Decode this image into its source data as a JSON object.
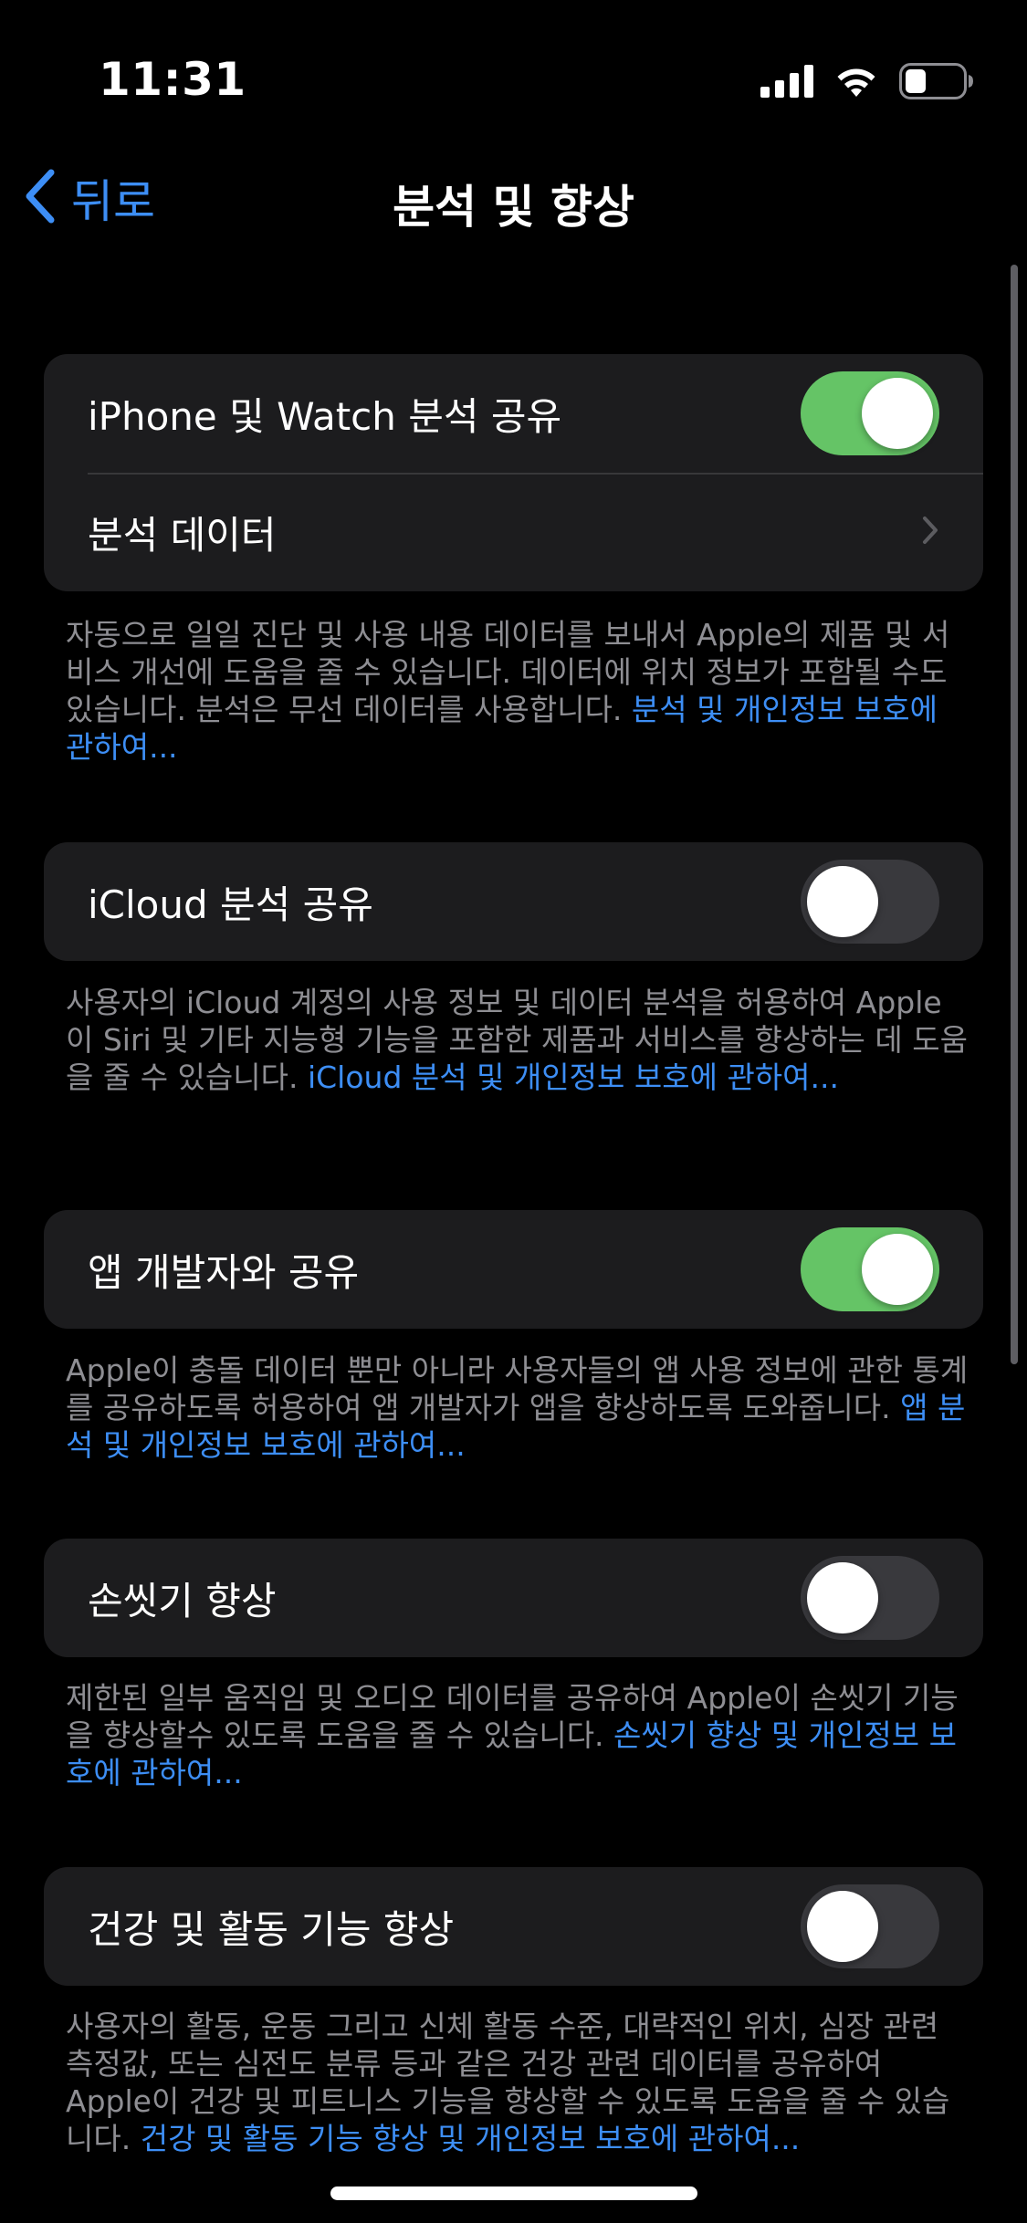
{
  "status_bar": {
    "time": "11:31",
    "icons": [
      "cellular-signal-icon",
      "wifi-icon",
      "battery-icon"
    ]
  },
  "nav": {
    "back_label": "뒤로",
    "title": "분석 및 향상"
  },
  "colors": {
    "background": "#000000",
    "group_background": "#1c1c1e",
    "toggle_on": "#65c466",
    "toggle_off": "#39393d",
    "link": "#3d8ef5",
    "footer_text": "#8e8e93"
  },
  "groups": [
    {
      "rows": [
        {
          "label": "iPhone 및 Watch 분석 공유",
          "type": "toggle",
          "on": true
        },
        {
          "label": "분석 데이터",
          "type": "disclosure"
        }
      ],
      "footer": {
        "text": "자동으로 일일 진단 및 사용 내용 데이터를 보내서 Apple의 제품 및 서비스 개선에 도움을 줄 수 있습니다. 데이터에 위치 정보가 포함될 수도 있습니다. 분석은 무선 데이터를 사용합니다. ",
        "link": "분석 및 개인정보 보호에 관하여..."
      }
    },
    {
      "rows": [
        {
          "label": "iCloud 분석 공유",
          "type": "toggle",
          "on": false
        }
      ],
      "footer": {
        "text": "사용자의 iCloud 계정의 사용 정보 및 데이터 분석을 허용하여 Apple이 Siri 및 기타 지능형 기능을 포함한 제품과 서비스를 향상하는 데 도움을 줄 수 있습니다. ",
        "link": "iCloud 분석 및 개인정보 보호에 관하여..."
      }
    },
    {
      "rows": [
        {
          "label": "앱 개발자와 공유",
          "type": "toggle",
          "on": true
        }
      ],
      "footer": {
        "text": "Apple이 충돌 데이터 뿐만 아니라 사용자들의 앱 사용 정보에 관한 통계를 공유하도록 허용하여 앱 개발자가 앱을 향상하도록 도와줍니다. ",
        "link": "앱 분석 및 개인정보 보호에 관하여..."
      }
    },
    {
      "rows": [
        {
          "label": "손씻기 향상",
          "type": "toggle",
          "on": false
        }
      ],
      "footer": {
        "text": "제한된 일부 움직임 및 오디오 데이터를 공유하여 Apple이 손씻기 기능을 향상할수 있도록 도움을 줄 수 있습니다. ",
        "link": "손씻기 향상 및 개인정보 보호에 관하여..."
      }
    },
    {
      "rows": [
        {
          "label": "건강 및 활동 기능 향상",
          "type": "toggle",
          "on": false
        }
      ],
      "footer": {
        "text": "사용자의 활동, 운동 그리고 신체 활동 수준, 대략적인 위치, 심장 관련 측정값, 또는 심전도 분류 등과 같은 건강 관련 데이터를 공유하여 Apple이 건강 및 피트니스 기능을 향상할 수 있도록 도움을 줄 수 있습니다. ",
        "link": "건강 및 활동 기능 향상 및 개인정보 보호에 관하여..."
      }
    }
  ]
}
